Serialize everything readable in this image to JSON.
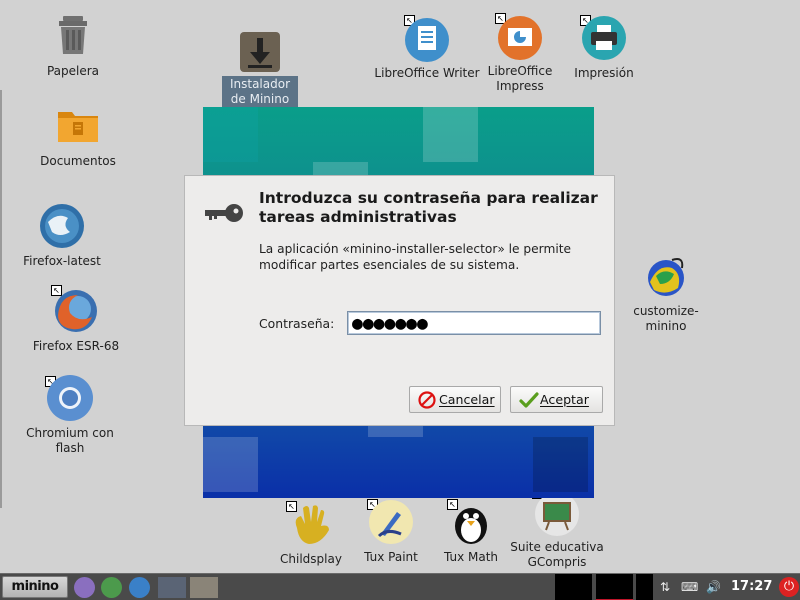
{
  "desktop": {
    "icons": {
      "trash": "Papelera",
      "documents": "Documentos",
      "firefox_latest": "Firefox-latest",
      "firefox_esr": "Firefox ESR-68",
      "chromium": "Chromium con flash",
      "installer": "Instalador de Minino",
      "writer": "LibreOffice Writer",
      "impress": "LibreOffice Impress",
      "print": "Impresión",
      "customize": "customize-minino",
      "childsplay": "Childsplay",
      "tuxpaint": "Tux Paint",
      "tuxmath": "Tux Math",
      "gcompris": "Suite educativa GCompris"
    }
  },
  "dialog": {
    "title": "Introduzca su contraseña para realizar tareas administrativas",
    "message": "La aplicación «minino-installer-selector» le permite modificar partes esenciales de su sistema.",
    "password_label": "Contraseña:",
    "password_value": "●●●●●●●",
    "cancel_label": "Cancelar",
    "accept_label": "Aceptar"
  },
  "taskbar": {
    "start_label": "minino",
    "clock": "17:27"
  },
  "colors": {
    "desktop_bg": "#d2d2d2",
    "dialog_bg": "#edeceb",
    "taskbar_bg": "#4a4a4a"
  }
}
